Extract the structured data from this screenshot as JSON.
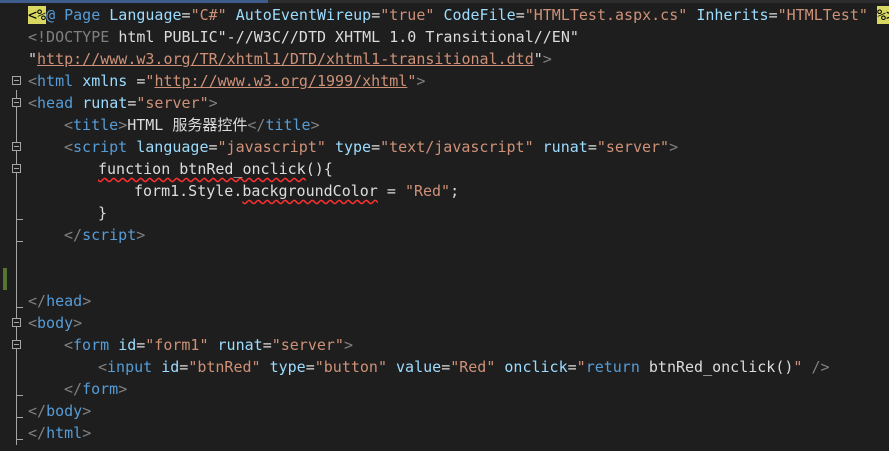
{
  "editor": {
    "language": "aspx",
    "colors": {
      "background": "#1e1e1e",
      "keyword": "#569cd6",
      "attribute": "#9cdcfe",
      "string": "#ce9178",
      "text": "#dcdcdc",
      "directive_background": "#d7d761",
      "change_marker": "#577430"
    },
    "lines": [
      {
        "segments": [
          {
            "t": "<%",
            "c": "c-dir-bg"
          },
          {
            "t": "@ ",
            "c": "c-key"
          },
          {
            "t": "Page ",
            "c": "c-key"
          },
          {
            "t": "Language",
            "c": "c-attr"
          },
          {
            "t": "=",
            "c": "c-text"
          },
          {
            "t": "\"C#\" ",
            "c": "c-str"
          },
          {
            "t": "AutoEventWireup",
            "c": "c-attr"
          },
          {
            "t": "=",
            "c": "c-text"
          },
          {
            "t": "\"true\" ",
            "c": "c-str"
          },
          {
            "t": "CodeFile",
            "c": "c-attr"
          },
          {
            "t": "=",
            "c": "c-text"
          },
          {
            "t": "\"HTMLTest.aspx.cs\" ",
            "c": "c-str"
          },
          {
            "t": "Inherits",
            "c": "c-attr"
          },
          {
            "t": "=",
            "c": "c-text"
          },
          {
            "t": "\"HTMLTest\" ",
            "c": "c-str"
          },
          {
            "t": "%>",
            "c": "c-dir-bg"
          }
        ]
      },
      {
        "segments": [
          {
            "t": "<!DOCTYPE ",
            "c": "c-gray"
          },
          {
            "t": "html PUBLIC",
            "c": "c-black"
          },
          {
            "t": "\"-//W3C//DTD XHTML 1.0 Transitional//EN\"",
            "c": "c-black"
          }
        ]
      },
      {
        "segments": [
          {
            "t": "\"",
            "c": "c-black"
          },
          {
            "t": "http://www.w3.org/TR/xhtml1/DTD/xhtml1-transitional.dtd",
            "c": "c-url"
          },
          {
            "t": "\"",
            "c": "c-black"
          },
          {
            "t": ">",
            "c": "c-gray"
          }
        ]
      },
      {
        "segments": [
          {
            "t": "<",
            "c": "c-gray"
          },
          {
            "t": "html ",
            "c": "c-key"
          },
          {
            "t": "xmlns ",
            "c": "c-attr"
          },
          {
            "t": "=",
            "c": "c-text"
          },
          {
            "t": "\"",
            "c": "c-str"
          },
          {
            "t": "http://www.w3.org/1999/xhtml",
            "c": "c-url"
          },
          {
            "t": "\"",
            "c": "c-str"
          },
          {
            "t": ">",
            "c": "c-gray"
          }
        ]
      },
      {
        "segments": [
          {
            "t": "<",
            "c": "c-gray"
          },
          {
            "t": "head ",
            "c": "c-key"
          },
          {
            "t": "runat",
            "c": "c-attr"
          },
          {
            "t": "=",
            "c": "c-text"
          },
          {
            "t": "\"server\"",
            "c": "c-str"
          },
          {
            "t": ">",
            "c": "c-gray"
          }
        ]
      },
      {
        "segments": [
          {
            "t": "<",
            "c": "c-gray"
          },
          {
            "t": "title",
            "c": "c-key"
          },
          {
            "t": ">",
            "c": "c-gray"
          },
          {
            "t": "HTML 服务器控件",
            "c": "c-text"
          },
          {
            "t": "</",
            "c": "c-gray"
          },
          {
            "t": "title",
            "c": "c-key"
          },
          {
            "t": ">",
            "c": "c-gray"
          }
        ]
      },
      {
        "segments": [
          {
            "t": "<",
            "c": "c-gray"
          },
          {
            "t": "script ",
            "c": "c-key"
          },
          {
            "t": "language",
            "c": "c-attr"
          },
          {
            "t": "=",
            "c": "c-text"
          },
          {
            "t": "\"javascript\" ",
            "c": "c-str"
          },
          {
            "t": "type",
            "c": "c-attr"
          },
          {
            "t": "=",
            "c": "c-text"
          },
          {
            "t": "\"text/javascript\" ",
            "c": "c-str"
          },
          {
            "t": "runat",
            "c": "c-attr"
          },
          {
            "t": "=",
            "c": "c-text"
          },
          {
            "t": "\"server\"",
            "c": "c-str"
          },
          {
            "t": ">",
            "c": "c-gray"
          }
        ]
      },
      {
        "segments": [
          {
            "t": "function ",
            "c": "c-text squiggle"
          },
          {
            "t": "btnRed_onclick",
            "c": "c-text squiggle"
          },
          {
            "t": "(){",
            "c": "c-text"
          }
        ]
      },
      {
        "segments": [
          {
            "t": "form1.Style.",
            "c": "c-text"
          },
          {
            "t": "backgroundColor",
            "c": "c-text squiggle"
          },
          {
            "t": " = ",
            "c": "c-text"
          },
          {
            "t": "\"Red\"",
            "c": "c-str"
          },
          {
            "t": ";",
            "c": "c-text"
          }
        ]
      },
      {
        "segments": [
          {
            "t": "}",
            "c": "c-text"
          }
        ]
      },
      {
        "segments": [
          {
            "t": "</",
            "c": "c-gray"
          },
          {
            "t": "script",
            "c": "c-key"
          },
          {
            "t": ">",
            "c": "c-gray"
          }
        ]
      },
      {
        "segments": []
      },
      {
        "segments": []
      },
      {
        "segments": [
          {
            "t": "</",
            "c": "c-gray"
          },
          {
            "t": "head",
            "c": "c-key"
          },
          {
            "t": ">",
            "c": "c-gray"
          }
        ]
      },
      {
        "segments": [
          {
            "t": "<",
            "c": "c-gray"
          },
          {
            "t": "body",
            "c": "c-key"
          },
          {
            "t": ">",
            "c": "c-gray"
          }
        ]
      },
      {
        "segments": [
          {
            "t": "<",
            "c": "c-gray"
          },
          {
            "t": "form ",
            "c": "c-key"
          },
          {
            "t": "id",
            "c": "c-attr"
          },
          {
            "t": "=",
            "c": "c-text"
          },
          {
            "t": "\"form1\" ",
            "c": "c-str"
          },
          {
            "t": "runat",
            "c": "c-attr"
          },
          {
            "t": "=",
            "c": "c-text"
          },
          {
            "t": "\"server\"",
            "c": "c-str"
          },
          {
            "t": ">",
            "c": "c-gray"
          }
        ]
      },
      {
        "segments": [
          {
            "t": "<",
            "c": "c-gray"
          },
          {
            "t": "input ",
            "c": "c-key"
          },
          {
            "t": "id",
            "c": "c-attr"
          },
          {
            "t": "=",
            "c": "c-text"
          },
          {
            "t": "\"btnRed\" ",
            "c": "c-str"
          },
          {
            "t": "type",
            "c": "c-attr"
          },
          {
            "t": "=",
            "c": "c-text"
          },
          {
            "t": "\"button\" ",
            "c": "c-str"
          },
          {
            "t": "value",
            "c": "c-attr"
          },
          {
            "t": "=",
            "c": "c-text"
          },
          {
            "t": "\"Red\" ",
            "c": "c-str"
          },
          {
            "t": "onclick",
            "c": "c-attr"
          },
          {
            "t": "=",
            "c": "c-text"
          },
          {
            "t": "\"",
            "c": "c-str"
          },
          {
            "t": "return ",
            "c": "c-key"
          },
          {
            "t": "btnRed_onclick()",
            "c": "c-text"
          },
          {
            "t": "\" ",
            "c": "c-str"
          },
          {
            "t": "/>",
            "c": "c-gray"
          }
        ]
      },
      {
        "segments": [
          {
            "t": "</",
            "c": "c-gray"
          },
          {
            "t": "form",
            "c": "c-key"
          },
          {
            "t": ">",
            "c": "c-gray"
          }
        ]
      },
      {
        "segments": [
          {
            "t": "</",
            "c": "c-gray"
          },
          {
            "t": "body",
            "c": "c-key"
          },
          {
            "t": ">",
            "c": "c-gray"
          }
        ]
      },
      {
        "segments": [
          {
            "t": "</",
            "c": "c-gray"
          },
          {
            "t": "html",
            "c": "c-key"
          },
          {
            "t": ">",
            "c": "c-gray"
          }
        ]
      }
    ]
  }
}
